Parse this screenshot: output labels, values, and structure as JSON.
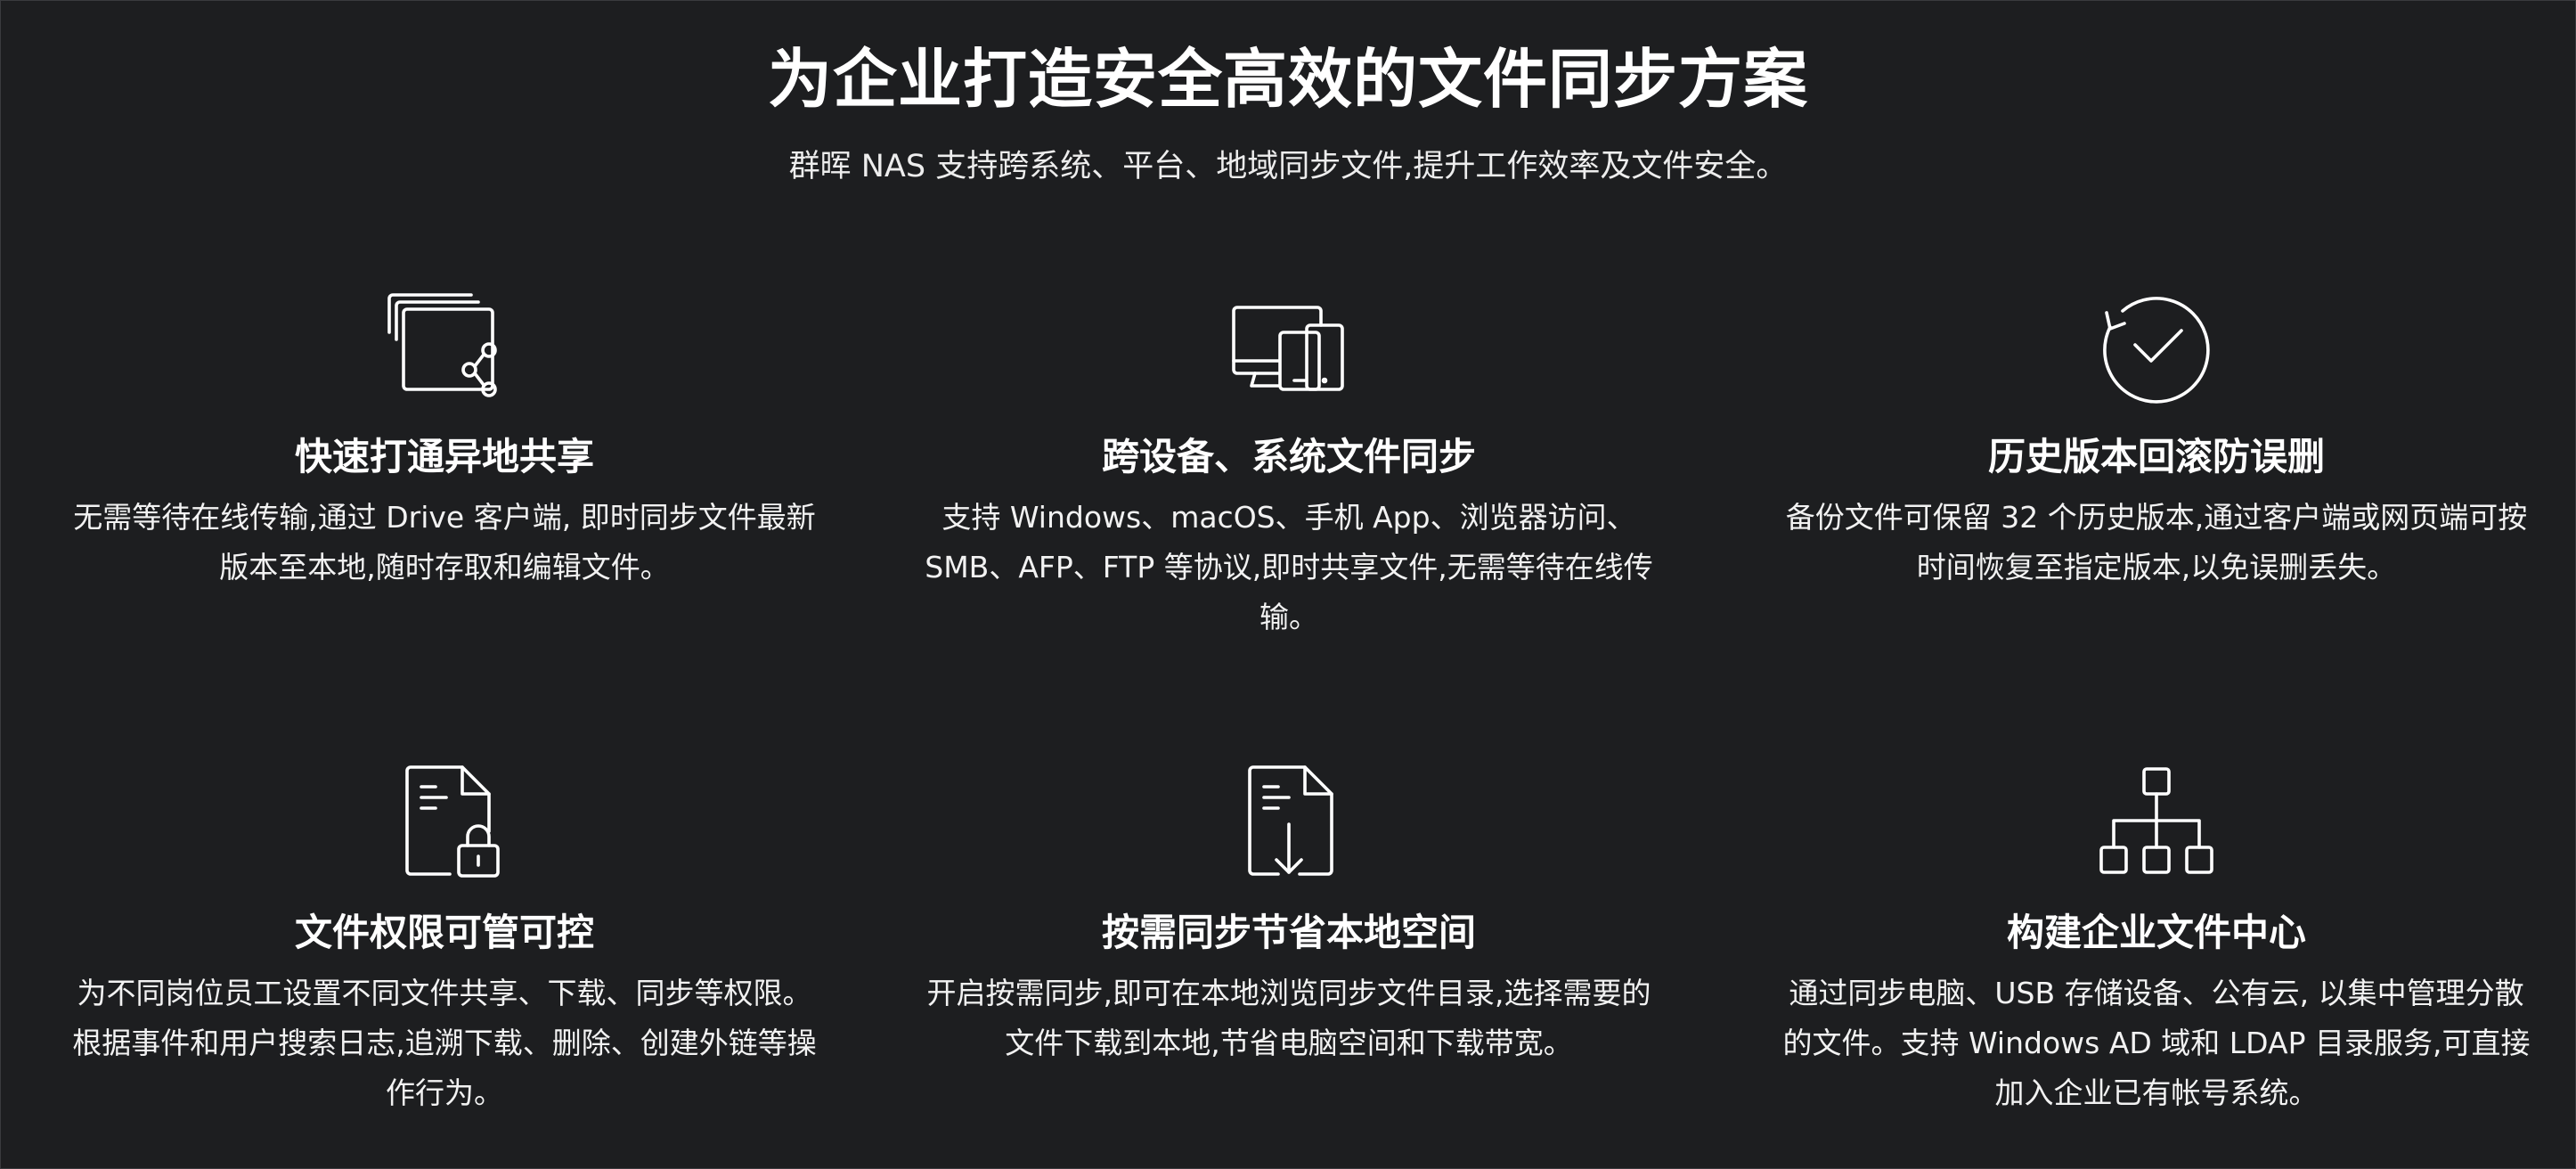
{
  "header": {
    "title": "为企业打造安全高效的文件同步方案",
    "subtitle": "群晖 NAS 支持跨系统、平台、地域同步文件,提升工作效率及文件安全。"
  },
  "features": [
    {
      "icon": "share-files-icon",
      "title": "快速打通异地共享",
      "description": "无需等待在线传输,通过 Drive 客户端, 即时同步文件最新版本至本地,随时存取和编辑文件。"
    },
    {
      "icon": "devices-icon",
      "title": "跨设备、系统文件同步",
      "description": "支持 Windows、macOS、手机 App、浏览器访问、SMB、AFP、FTP 等协议,即时共享文件,无需等待在线传输。"
    },
    {
      "icon": "history-check-icon",
      "title": "历史版本回滚防误删",
      "description": "备份文件可保留 32 个历史版本,通过客户端或网页端可按时间恢复至指定版本,以免误删丢失。"
    },
    {
      "icon": "file-lock-icon",
      "title": "文件权限可管可控",
      "description": "为不同岗位员工设置不同文件共享、下载、同步等权限。根据事件和用户搜索日志,追溯下载、删除、创建外链等操作行为。"
    },
    {
      "icon": "file-download-icon",
      "title": "按需同步节省本地空间",
      "description": "开启按需同步,即可在本地浏览同步文件目录,选择需要的文件下载到本地,节省电脑空间和下载带宽。"
    },
    {
      "icon": "org-chart-icon",
      "title": "构建企业文件中心",
      "description": "通过同步电脑、USB 存储设备、公有云, 以集中管理分散的文件。支持 Windows AD 域和 LDAP 目录服务,可直接加入企业已有帐号系统。"
    }
  ]
}
